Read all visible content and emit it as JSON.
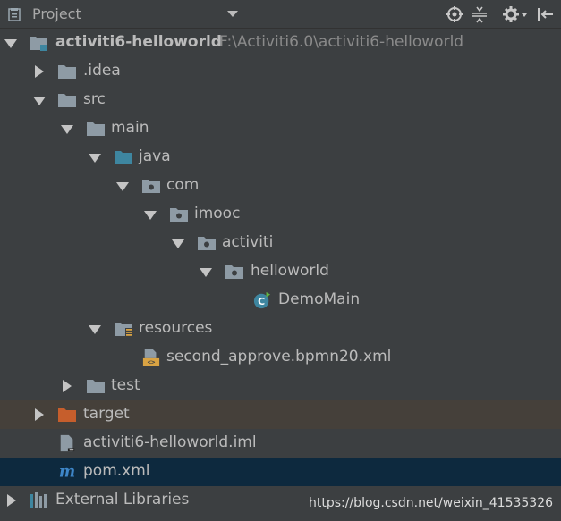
{
  "header": {
    "title": "Project",
    "icons": [
      "project-icon",
      "dropdown-arrow-icon",
      "locate-icon",
      "collapse-all-icon",
      "gear-icon",
      "hide-icon"
    ]
  },
  "tree": {
    "root_label": "activiti6-helloworld",
    "root_path": "F:\\Activiti6.0\\activiti6-helloworld",
    "idea": ".idea",
    "src": "src",
    "main": "main",
    "java": "java",
    "com": "com",
    "imooc": "imooc",
    "activiti": "activiti",
    "helloworld": "helloworld",
    "demomain": "DemoMain",
    "resources": "resources",
    "bpmn": "second_approve.bpmn20.xml",
    "test": "test",
    "target": "target",
    "iml": "activiti6-helloworld.iml",
    "pom": "pom.xml",
    "external": "External Libraries"
  },
  "watermark": "https://blog.csdn.net/weixin_41535326",
  "colors": {
    "background": "#3c3f41",
    "selected_row": "#0d293e",
    "excluded_row": "#45403a",
    "folder": "#8e9ba5",
    "source_folder": "#3e86a0",
    "excluded_folder": "#c65e2c",
    "class_icon": "#3e86a0"
  }
}
